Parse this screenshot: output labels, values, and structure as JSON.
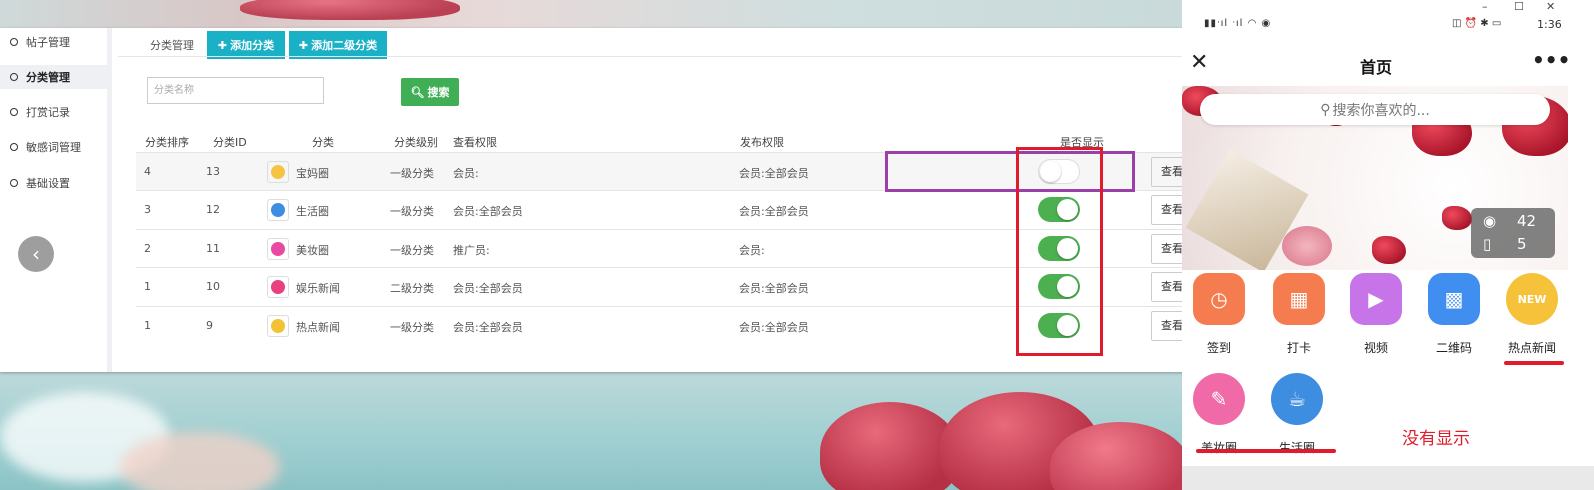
{
  "admin": {
    "sidebar": {
      "items": [
        {
          "label": "帖子管理",
          "active": false
        },
        {
          "label": "分类管理",
          "active": true
        },
        {
          "label": "打赏记录",
          "active": false
        },
        {
          "label": "敏感词管理",
          "active": false
        },
        {
          "label": "基础设置",
          "active": false
        }
      ],
      "back_icon": "chevron-left-icon"
    },
    "tabs": {
      "current": "分类管理",
      "add_category": "添加分类",
      "add_subcategory": "添加二级分类"
    },
    "search": {
      "placeholder": "分类名称",
      "button": "搜索"
    },
    "table": {
      "headers": [
        "分类排序",
        "分类ID",
        "分类",
        "分类级别",
        "查看权限",
        "发布权限",
        "是否显示"
      ],
      "rows": [
        {
          "order": "4",
          "id": "13",
          "name": "宝妈圈",
          "level": "一级分类",
          "view": "会员:",
          "publish": "会员:全部会员",
          "shown": false,
          "action": "查看",
          "icon_color": "#f5c542"
        },
        {
          "order": "3",
          "id": "12",
          "name": "生活圈",
          "level": "一级分类",
          "view": "会员:全部会员",
          "publish": "会员:全部会员",
          "shown": true,
          "action": "查看",
          "icon_color": "#3d8de0"
        },
        {
          "order": "2",
          "id": "11",
          "name": "美妆圈",
          "level": "一级分类",
          "view": "推广员:",
          "publish": "会员:",
          "shown": true,
          "action": "查看",
          "icon_color": "#e84aa3"
        },
        {
          "order": "1",
          "id": "10",
          "name": "娱乐新闻",
          "level": "二级分类",
          "view": "会员:全部会员",
          "publish": "会员:全部会员",
          "shown": true,
          "action": "查看",
          "icon_color": "#e8417f"
        },
        {
          "order": "1",
          "id": "9",
          "name": "热点新闻",
          "level": "一级分类",
          "view": "会员:全部会员",
          "publish": "会员:全部会员",
          "shown": true,
          "action": "查看",
          "icon_color": "#f2c232"
        }
      ]
    }
  },
  "phone": {
    "status_bar": {
      "time": "1:36",
      "left_icons": "signal-wifi-eye-icons",
      "right_icons": "nfc-alarm-bluetooth-battery-icons"
    },
    "nav": {
      "title": "首页",
      "close_icon": "close-icon",
      "more_icon": "more-dots-icon"
    },
    "search": {
      "placeholder": "搜索你喜欢的..."
    },
    "stats": {
      "views": "42",
      "posts": "5"
    },
    "grid": [
      {
        "label": "签到",
        "icon": "clock-icon",
        "color": "#f47c4e"
      },
      {
        "label": "打卡",
        "icon": "calendar-check-icon",
        "color": "#f47c4e"
      },
      {
        "label": "视频",
        "icon": "video-camera-icon",
        "color": "#c774e8"
      },
      {
        "label": "二维码",
        "icon": "qrcode-icon",
        "color": "#3f8ef0"
      },
      {
        "label": "热点新闻",
        "icon": "new-badge-icon",
        "color": "#f5c23a"
      },
      {
        "label": "美妆圈",
        "icon": "makeup-icon",
        "color": "#f06aa8"
      },
      {
        "label": "生活圈",
        "icon": "cup-icon",
        "color": "#3d8de0"
      }
    ],
    "annotation": "没有显示"
  },
  "colors": {
    "accent_add": "#1ab0c5",
    "search_green": "#3fae55",
    "toggle_on": "#4caf50",
    "annot_red": "#e01b2c",
    "annot_purple": "#9c3fa8"
  }
}
